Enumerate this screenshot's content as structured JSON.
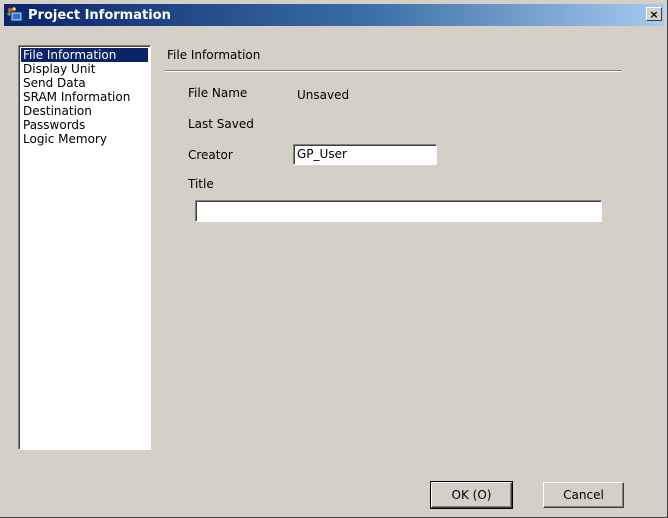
{
  "window": {
    "title": "Project Information",
    "close_label": "×"
  },
  "nav": {
    "items": [
      {
        "label": "File Information",
        "selected": true
      },
      {
        "label": "Display Unit"
      },
      {
        "label": "Send Data"
      },
      {
        "label": "SRAM Information"
      },
      {
        "label": "Destination"
      },
      {
        "label": "Passwords"
      },
      {
        "label": "Logic Memory"
      }
    ]
  },
  "panel": {
    "heading": "File Information",
    "file_name_label": "File Name",
    "file_name_value": "Unsaved",
    "last_saved_label": "Last Saved",
    "last_saved_value": "",
    "creator_label": "Creator",
    "creator_value": "GP_User",
    "title_label": "Title",
    "title_value": ""
  },
  "buttons": {
    "ok": "OK (O)",
    "cancel": "Cancel"
  },
  "colors": {
    "titlebar_start": "#0a246a",
    "titlebar_end": "#a6caf0",
    "selection": "#0a246a",
    "face": "#d4d0c8"
  }
}
